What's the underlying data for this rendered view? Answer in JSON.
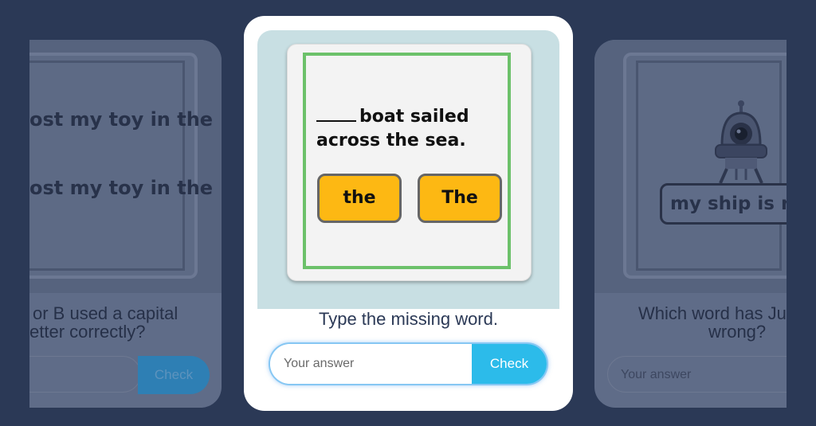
{
  "left_card": {
    "line1": "ost my toy in the",
    "line2": "ost my toy in the",
    "question_line1": "or B used a capital",
    "question_line2": "etter correctly?",
    "check_label": "Check"
  },
  "main_card": {
    "sentence": "boat sailed across the sea.",
    "option_a": "the",
    "option_b": "The",
    "question": "Type the missing word.",
    "answer_placeholder": "Your answer",
    "check_label": "Check"
  },
  "right_card": {
    "phrase": "my ship is re",
    "question_line1": "Which word has Ju",
    "question_line2": "wrong?",
    "answer_placeholder": "Your answer"
  },
  "colors": {
    "background": "#2b3956",
    "option": "#fdb813",
    "check": "#2cbbea",
    "frame": "#6cc16a"
  }
}
